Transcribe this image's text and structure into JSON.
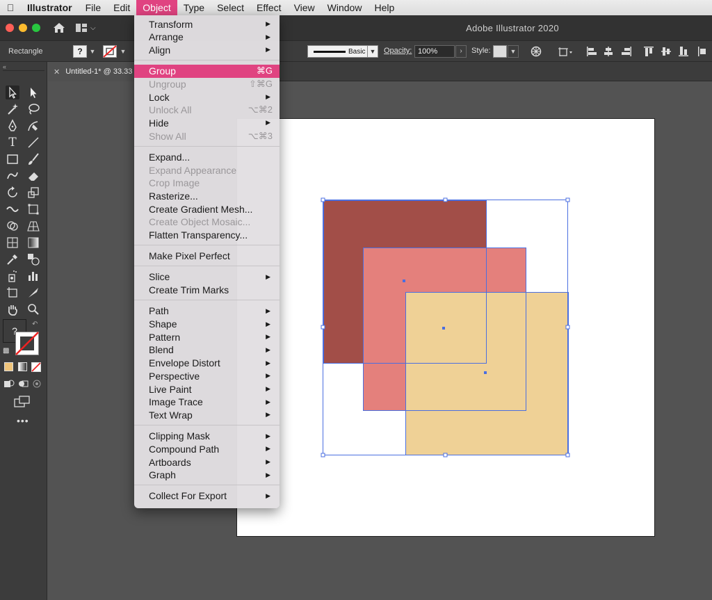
{
  "menubar": {
    "app_name": "Illustrator",
    "items": [
      "File",
      "Edit",
      "Object",
      "Type",
      "Select",
      "Effect",
      "View",
      "Window",
      "Help"
    ],
    "active_item": "Object"
  },
  "window": {
    "title": "Adobe Illustrator 2020"
  },
  "control_bar": {
    "selection_label": "Rectangle",
    "fill_swatch": "?",
    "stroke_profile": "Basic",
    "opacity_label": "Opacity:",
    "opacity_value": "100%",
    "style_label": "Style:"
  },
  "tab": {
    "title": "Untitled-1* @ 33.33"
  },
  "toolbar": {
    "fill_unknown": "?"
  },
  "object_menu": {
    "items": [
      {
        "label": "Transform",
        "submenu": true,
        "enabled": true
      },
      {
        "label": "Arrange",
        "submenu": true,
        "enabled": true
      },
      {
        "label": "Align",
        "submenu": true,
        "enabled": true
      },
      {
        "label": "Group",
        "shortcut": "⌘G",
        "enabled": true,
        "highlighted": true
      },
      {
        "label": "Ungroup",
        "shortcut": "⇧⌘G",
        "enabled": false
      },
      {
        "label": "Lock",
        "submenu": true,
        "enabled": true
      },
      {
        "label": "Unlock All",
        "shortcut": "⌥⌘2",
        "enabled": false
      },
      {
        "label": "Hide",
        "submenu": true,
        "enabled": true
      },
      {
        "label": "Show All",
        "shortcut": "⌥⌘3",
        "enabled": false
      },
      {
        "label": "Expand...",
        "enabled": true
      },
      {
        "label": "Expand Appearance",
        "enabled": false
      },
      {
        "label": "Crop Image",
        "enabled": false
      },
      {
        "label": "Rasterize...",
        "enabled": true
      },
      {
        "label": "Create Gradient Mesh...",
        "enabled": true
      },
      {
        "label": "Create Object Mosaic...",
        "enabled": false
      },
      {
        "label": "Flatten Transparency...",
        "enabled": true
      },
      {
        "label": "Make Pixel Perfect",
        "enabled": true
      },
      {
        "label": "Slice",
        "submenu": true,
        "enabled": true
      },
      {
        "label": "Create Trim Marks",
        "enabled": true
      },
      {
        "label": "Path",
        "submenu": true,
        "enabled": true
      },
      {
        "label": "Shape",
        "submenu": true,
        "enabled": true
      },
      {
        "label": "Pattern",
        "submenu": true,
        "enabled": true
      },
      {
        "label": "Blend",
        "submenu": true,
        "enabled": true
      },
      {
        "label": "Envelope Distort",
        "submenu": true,
        "enabled": true
      },
      {
        "label": "Perspective",
        "submenu": true,
        "enabled": true
      },
      {
        "label": "Live Paint",
        "submenu": true,
        "enabled": true
      },
      {
        "label": "Image Trace",
        "submenu": true,
        "enabled": true
      },
      {
        "label": "Text Wrap",
        "submenu": true,
        "enabled": true
      },
      {
        "label": "Clipping Mask",
        "submenu": true,
        "enabled": true
      },
      {
        "label": "Compound Path",
        "submenu": true,
        "enabled": true
      },
      {
        "label": "Artboards",
        "submenu": true,
        "enabled": true
      },
      {
        "label": "Graph",
        "submenu": true,
        "enabled": true
      },
      {
        "label": "Collect For Export",
        "submenu": true,
        "enabled": true
      }
    ]
  },
  "artwork": {
    "shapes": [
      {
        "name": "dark-red-square",
        "color": "#a24e48"
      },
      {
        "name": "pink-square",
        "color": "#e4807c"
      },
      {
        "name": "tan-square",
        "color": "#efd196"
      }
    ],
    "selection_color": "#4a6ee0"
  },
  "colors": {
    "menu_highlight": "#e04381"
  }
}
